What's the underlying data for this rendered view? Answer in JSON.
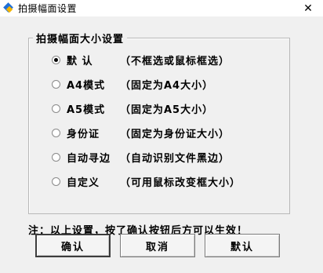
{
  "window": {
    "title": "拍摄幅面设置",
    "close_glyph": "✕",
    "app_icon": "app-logo-icon"
  },
  "group": {
    "title": "拍摄幅面大小设置",
    "options": [
      {
        "label": "默  认",
        "desc": "（不框选或鼠标框选）",
        "checked": true
      },
      {
        "label": "A4模式",
        "desc": "（固定为A4大小）",
        "checked": false
      },
      {
        "label": "A5模式",
        "desc": "（固定为A5大小）",
        "checked": false
      },
      {
        "label": "身份证",
        "desc": "（固定为身份证大小）",
        "checked": false
      },
      {
        "label": "自动寻边",
        "desc": "（自动识别文件黑边）",
        "checked": false
      },
      {
        "label": "自定义",
        "desc": "（可用鼠标改变框大小）",
        "checked": false
      }
    ]
  },
  "note": "注：以上设置，按了确认按钮后方可以生效！",
  "buttons": {
    "ok": "确认",
    "cancel": "取消",
    "default": "默认"
  }
}
